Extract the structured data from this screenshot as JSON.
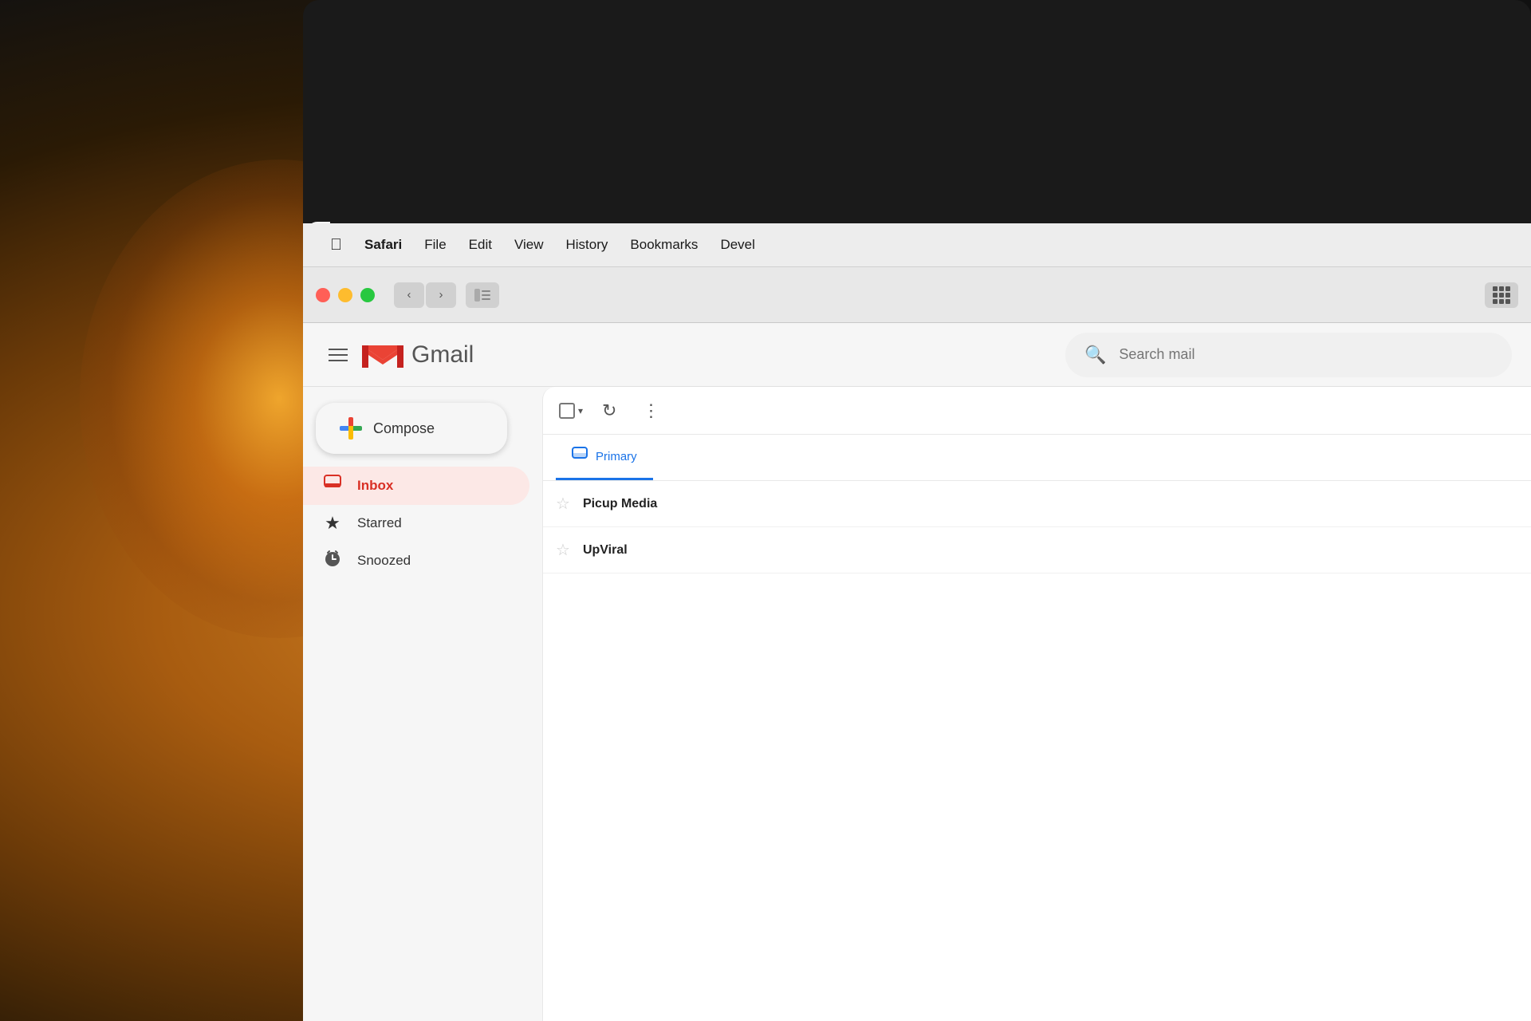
{
  "background": {
    "glow_color": "rgba(220,140,30,0.85)"
  },
  "menubar": {
    "apple": "&#63743;",
    "items": [
      {
        "label": "Safari",
        "bold": true
      },
      {
        "label": "File",
        "bold": false
      },
      {
        "label": "Edit",
        "bold": false
      },
      {
        "label": "View",
        "bold": false
      },
      {
        "label": "History",
        "bold": false
      },
      {
        "label": "Bookmarks",
        "bold": false
      },
      {
        "label": "Devel",
        "bold": false
      }
    ]
  },
  "browser": {
    "back_arrow": "‹",
    "forward_arrow": "›",
    "sidebar_icon": "⊞"
  },
  "gmail": {
    "app_name": "Gmail",
    "search_placeholder": "Search mail",
    "compose_label": "Compose",
    "sidebar_items": [
      {
        "label": "Inbox",
        "active": true
      },
      {
        "label": "Starred",
        "active": false
      },
      {
        "label": "Snoozed",
        "active": false
      }
    ],
    "tabs": [
      {
        "label": "Primary",
        "active": true
      }
    ],
    "toolbar": {
      "more_dots": "⋮",
      "refresh": "↻",
      "dropdown": "▾"
    },
    "email_rows": [
      {
        "sender": "Picup Media",
        "starred": false
      },
      {
        "sender": "UpViral",
        "starred": false
      }
    ]
  }
}
